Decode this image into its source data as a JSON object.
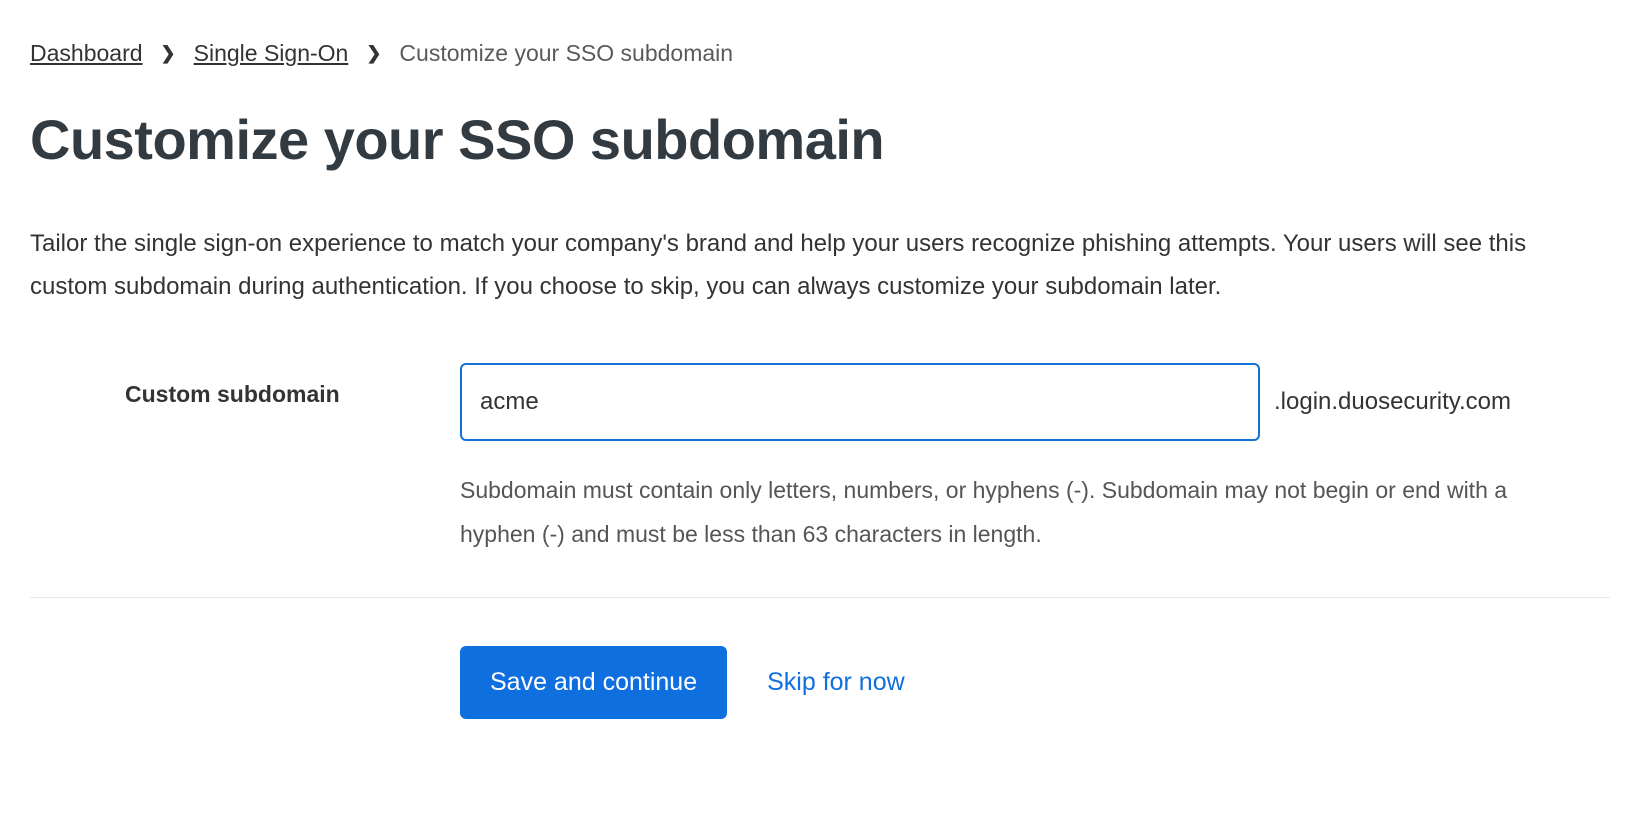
{
  "breadcrumb": {
    "items": [
      {
        "label": "Dashboard",
        "link": true
      },
      {
        "label": "Single Sign-On",
        "link": true
      },
      {
        "label": "Customize your SSO subdomain",
        "link": false
      }
    ]
  },
  "page": {
    "title": "Customize your SSO subdomain",
    "description": "Tailor the single sign-on experience to match your company's brand and help your users recognize phishing attempts. Your users will see this custom subdomain during authentication. If you choose to skip, you can always customize your subdomain later."
  },
  "form": {
    "subdomain_label": "Custom subdomain",
    "subdomain_value": "acme",
    "domain_suffix": ".login.duosecurity.com",
    "help_text": "Subdomain must contain only letters, numbers, or hyphens (-). Subdomain may not begin or end with a hyphen (-) and must be less than 63 characters in length."
  },
  "buttons": {
    "save_label": "Save and continue",
    "skip_label": "Skip for now"
  }
}
